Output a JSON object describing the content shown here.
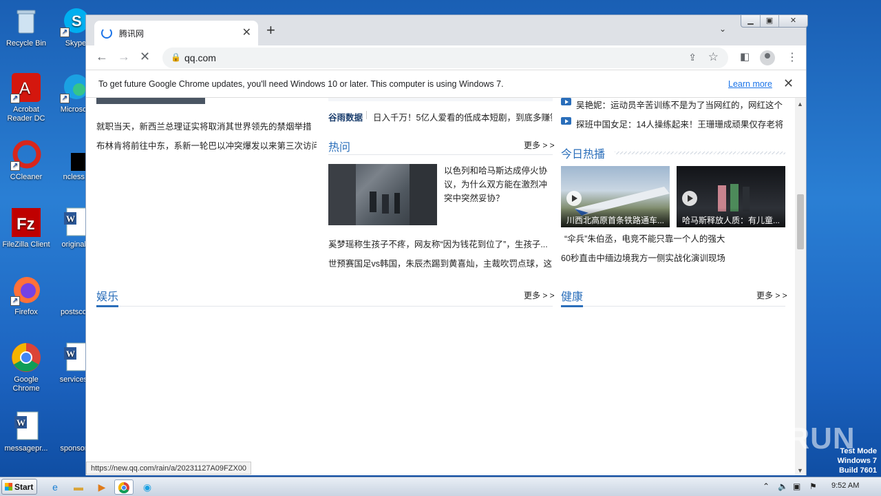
{
  "desktop": {
    "icons": [
      {
        "label": "Recycle Bin"
      },
      {
        "label": "Skype"
      },
      {
        "label": "Acrobat Reader DC"
      },
      {
        "label": "Microsoft"
      },
      {
        "label": "CCleaner"
      },
      {
        "label": "ncless.j"
      },
      {
        "label": "FileZilla Client"
      },
      {
        "label": "originalc"
      },
      {
        "label": "Firefox"
      },
      {
        "label": "postscon"
      },
      {
        "label": "Google Chrome"
      },
      {
        "label": "servicesp"
      },
      {
        "label": "messagepr..."
      },
      {
        "label": "sponsore"
      }
    ]
  },
  "browser": {
    "tab_title": "腾讯网",
    "url": "qq.com",
    "infobar_message": "To get future Google Chrome updates, you'll need Windows 10 or later. This computer is using Windows 7.",
    "infobar_link": "Learn more",
    "status_url": "https://new.qq.com/rain/a/20231127A09FZX00"
  },
  "page": {
    "left_news": [
      "就职当天，新西兰总理证实将取消其世界领先的禁烟举措",
      "布林肯将前往中东，系新一轮巴以冲突爆发以来第三次访问"
    ],
    "mid_top": {
      "source": "谷雨数据",
      "text": "日入千万！5亿人爱看的低成本短剧，到底多赚钱"
    },
    "hot": {
      "title": "热问",
      "more": "更多 > >",
      "feature_text": "以色列和哈马斯达成停火协议，为什么双方能在激烈冲突中突然妥协？",
      "items": [
        "奚梦瑶称生孩子不疼，网友称“因为钱花到位了”，生孩子...",
        "世预赛国足vs韩国，朱辰杰踢到黄喜灿，主裁吹罚点球，这..."
      ]
    },
    "right_top": [
      "吴艳妮：运动员辛苦训练不是为了当网红的，网红这个...",
      "探班中国女足：14人操练起来！王珊珊成顽果仅存老将..."
    ],
    "today_hot": {
      "title": "今日热播",
      "videos": [
        {
          "caption": "川西北高原首条铁路通车..."
        },
        {
          "caption": "哈马斯释放人质：有儿童..."
        }
      ],
      "items": [
        "“伞兵”朱伯丞，电竞不能只靠一个人的强大",
        "60秒直击中缅边境我方一侧实战化演训现场"
      ]
    },
    "ent": {
      "title": "娱乐",
      "more": "更多 > >"
    },
    "health": {
      "title": "健康",
      "more": "更多 > >"
    }
  },
  "taskbar": {
    "start_label": "Start",
    "clock": "9:52 AM"
  },
  "watermark": "ANY RUN",
  "test_mode": [
    "Test Mode",
    "Windows 7",
    "Build 7601"
  ],
  "colors": {
    "accent": "#2a6eba",
    "chrome_frame": "#dee1e6"
  }
}
